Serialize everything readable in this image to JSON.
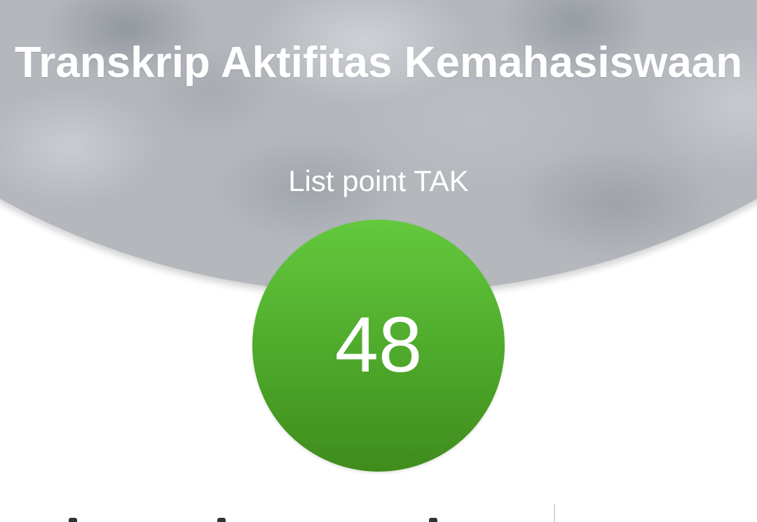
{
  "header": {
    "title": "Transkrip Aktifitas Kemahasiswaan",
    "subtitle": "List point TAK"
  },
  "points": {
    "value": "48",
    "color": "#52ad2e"
  },
  "colors": {
    "header_background": "#b4b8bd",
    "text_on_header": "#ffffff",
    "page_background": "#ffffff"
  }
}
